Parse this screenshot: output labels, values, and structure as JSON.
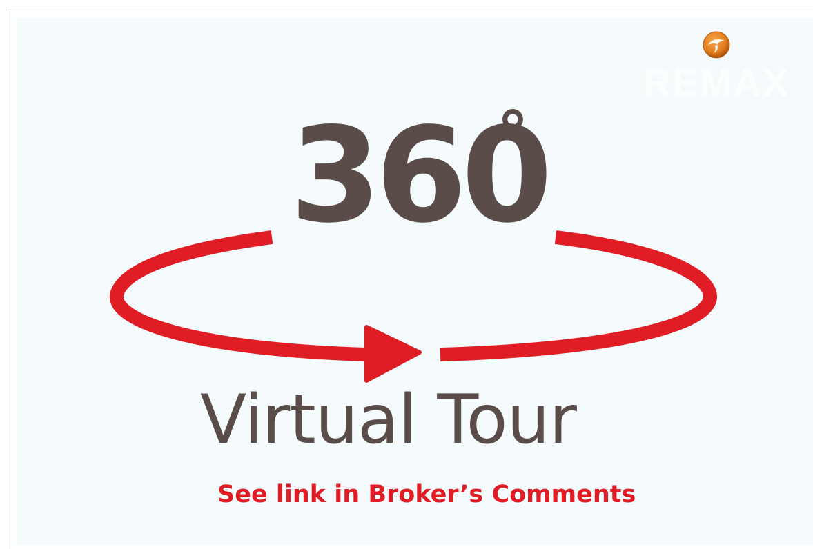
{
  "banner": {
    "headline": "360",
    "degree_symbol": "°",
    "subtitle": "Virtual Tour",
    "call_to_action": "See link in Broker’s Comments",
    "brand_icon": "swallow-logo-icon",
    "brand_text": "REMAX"
  },
  "colors": {
    "headline": "#5a4d49",
    "accent": "#e01d25",
    "panel_background": "#f5fbfd",
    "brand_icon": "#e27c1c"
  }
}
